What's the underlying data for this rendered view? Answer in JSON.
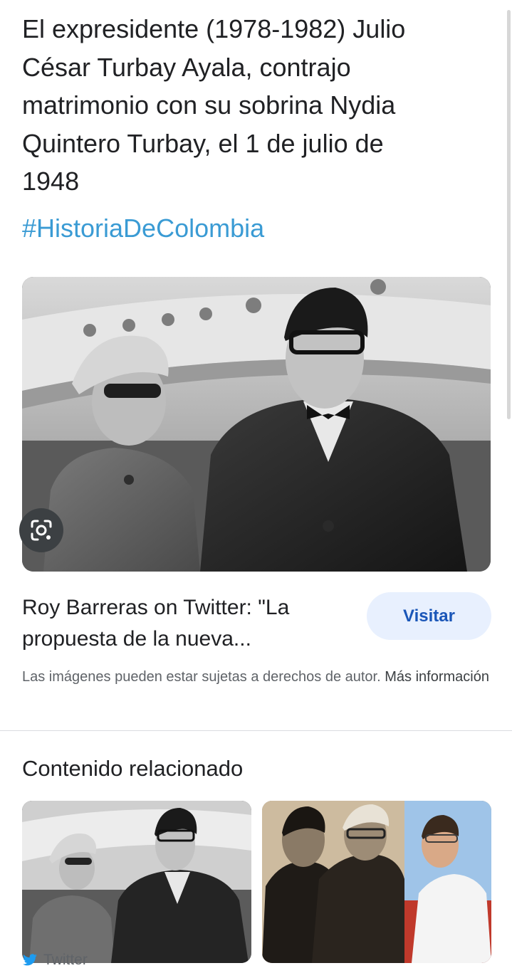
{
  "tweet": {
    "text": "El expresidente (1978-1982) Julio César Turbay Ayala, contrajo matrimonio con su sobrina Nydia Quintero Turbay, el 1 de julio de 1948",
    "lines": [
      "El expresidente (1978-1982) Julio",
      "César Turbay Ayala, contrajo",
      "matrimonio con su sobrina Nydia",
      "Quintero Turbay, el 1 de julio de",
      "1948"
    ],
    "hashtag": "#HistoriaDeColombia"
  },
  "result": {
    "title_line1": "Roy Barreras on Twitter: \"La",
    "title_line2": "propuesta de la nueva...",
    "visit_label": "Visitar",
    "copyright_text": "Las imágenes pueden estar sujetas a derechos de autor.",
    "more_info_label": "Más información"
  },
  "related": {
    "title": "Contenido relacionado",
    "items": [
      {
        "source": "Twitter",
        "source_icon": "twitter-bird-icon"
      },
      {
        "source": ""
      }
    ]
  },
  "icons": {
    "lens": "google-lens-icon"
  },
  "colors": {
    "hashtag": "#3a9bd4",
    "visit_bg": "#e8f0fe",
    "visit_text": "#1a56b8",
    "twitter_blue": "#1d9bf0"
  }
}
